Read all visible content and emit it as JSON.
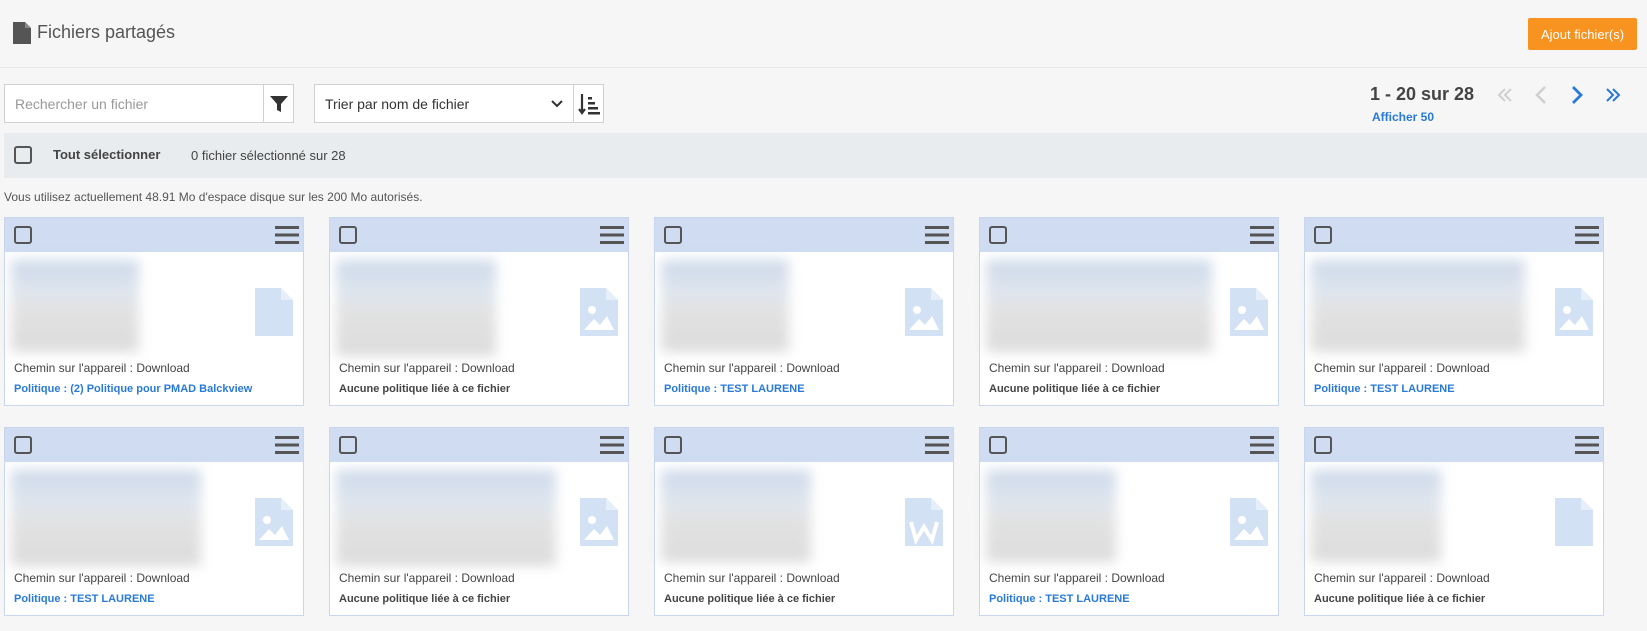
{
  "header": {
    "title": "Fichiers partagés",
    "add_button": "Ajout fichier(s)"
  },
  "toolbar": {
    "search_placeholder": "Rechercher un fichier",
    "sort_selected": "Trier par nom de fichier"
  },
  "pagination": {
    "range": "1 - 20 sur 28",
    "per_page": "Afficher 50"
  },
  "selection": {
    "select_all": "Tout sélectionner",
    "count": "0 fichier sélectionné sur 28"
  },
  "usage": "Vous utilisez actuellement 48.91 Mo d'espace disque sur les 200 Mo autorisés.",
  "colors": {
    "accent_orange": "#f7931e",
    "link_blue": "#2a7ad5",
    "card_header": "#cfdcf1",
    "icon_light_blue": "#d3e1f5"
  },
  "files": [
    {
      "icon": "file-icon",
      "path": "Chemin sur l'appareil : Download",
      "policy": "Politique : (2) Politique pour PMAD Balckview",
      "linked": true
    },
    {
      "icon": "image-icon",
      "path": "Chemin sur l'appareil : Download",
      "policy": "Aucune politique liée à ce fichier",
      "linked": false
    },
    {
      "icon": "image-icon",
      "path": "Chemin sur l'appareil : Download",
      "policy": "Politique : TEST LAURENE",
      "linked": true
    },
    {
      "icon": "image-icon",
      "path": "Chemin sur l'appareil : Download",
      "policy": "Aucune politique liée à ce fichier",
      "linked": false
    },
    {
      "icon": "image-icon",
      "path": "Chemin sur l'appareil : Download",
      "policy": "Politique : TEST LAURENE",
      "linked": true
    },
    {
      "icon": "image-icon",
      "path": "Chemin sur l'appareil : Download",
      "policy": "Politique : TEST LAURENE",
      "linked": true
    },
    {
      "icon": "image-icon",
      "path": "Chemin sur l'appareil : Download",
      "policy": "Aucune politique liée à ce fichier",
      "linked": false
    },
    {
      "icon": "word-file-icon",
      "path": "Chemin sur l'appareil : Download",
      "policy": "Aucune politique liée à ce fichier",
      "linked": false
    },
    {
      "icon": "image-icon",
      "path": "Chemin sur l'appareil : Download",
      "policy": "Politique : TEST LAURENE",
      "linked": true
    },
    {
      "icon": "file-icon",
      "path": "Chemin sur l'appareil : Download",
      "policy": "Aucune politique liée à ce fichier",
      "linked": false
    }
  ]
}
